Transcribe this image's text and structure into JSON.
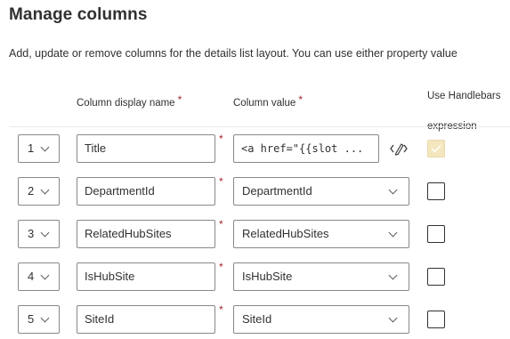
{
  "title": "Manage columns",
  "description": "Add, update or remove columns for the details list layout. You can use either property value",
  "headers": {
    "display_name": "Column display name",
    "column_value": "Column value",
    "handlebars": "Use Handlebars expression",
    "required_mark": "*"
  },
  "rows": [
    {
      "order": "1",
      "display_name": "Title",
      "value": "<a href=\"{{slot ...",
      "value_kind": "text",
      "use_handlebars": true
    },
    {
      "order": "2",
      "display_name": "DepartmentId",
      "value": "DepartmentId",
      "value_kind": "dropdown",
      "use_handlebars": false
    },
    {
      "order": "3",
      "display_name": "RelatedHubSites",
      "value": "RelatedHubSites",
      "value_kind": "dropdown",
      "use_handlebars": false
    },
    {
      "order": "4",
      "display_name": "IsHubSite",
      "value": "IsHubSite",
      "value_kind": "dropdown",
      "use_handlebars": false
    },
    {
      "order": "5",
      "display_name": "SiteId",
      "value": "SiteId",
      "value_kind": "dropdown",
      "use_handlebars": false
    }
  ],
  "colors": {
    "required": "#a4262c",
    "checked_fill": "#f4e7be"
  }
}
